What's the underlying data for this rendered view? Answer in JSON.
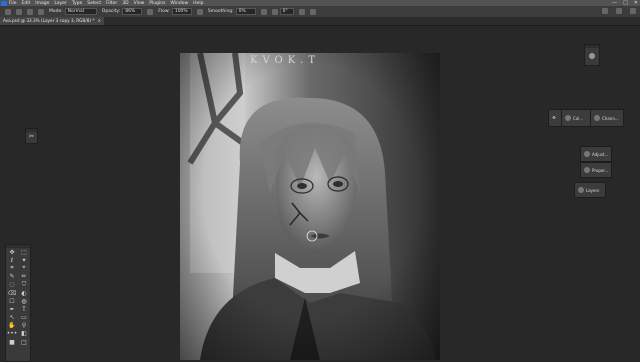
{
  "app": {
    "name": "Adobe Photoshop"
  },
  "menu": {
    "items": [
      "Ps",
      "File",
      "Edit",
      "Image",
      "Layer",
      "Type",
      "Select",
      "Filter",
      "3D",
      "View",
      "Plugins",
      "Window",
      "Help"
    ]
  },
  "window_controls": [
    "—",
    "□",
    "✕"
  ],
  "options_bar": {
    "mode_label": "Mode:",
    "mode_value": "Normal",
    "opacity_label": "Opacity:",
    "opacity_value": "86%",
    "flow_label": "Flow:",
    "flow_value": "100%",
    "smoothing_label": "Smoothing:",
    "smoothing_value": "0%",
    "angle_value": "0°"
  },
  "document_tab": {
    "title": "Ava.psd @ 33.3% (Layer 3 copy 3, RGB/8) *",
    "close": "×"
  },
  "panels": {
    "row1": [
      {
        "label": "Col..."
      },
      {
        "label": "Chann..."
      }
    ],
    "adjustments": "Adjust...",
    "properties": "Proper...",
    "layers": "Layers"
  },
  "artwork": {
    "signature": "KVOK.T"
  },
  "tools": [
    "✥",
    "⬚",
    "ℓ",
    "✦",
    "⌗",
    "⌖",
    "✎",
    "✏",
    "◌",
    "⛉",
    "⌫",
    "◐",
    "☐",
    "◍",
    "✒",
    "T",
    "↖",
    "▭",
    "✋",
    "⚲",
    "•••",
    "◧",
    "■",
    "□"
  ],
  "colors": {
    "accent": "#2b6fd6",
    "ui_dark": "#282828",
    "panel": "#3c3c3c"
  }
}
